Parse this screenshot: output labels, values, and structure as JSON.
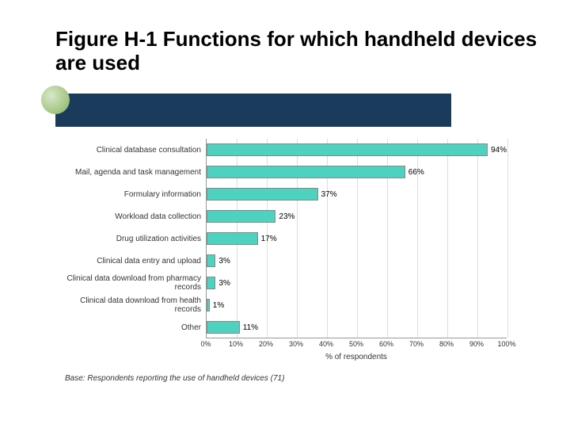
{
  "title": "Figure H-1 Functions for which handheld devices are used",
  "footnote": "Base:  Respondents reporting the use of handheld devices (71)",
  "chart_data": {
    "type": "bar",
    "orientation": "horizontal",
    "categories": [
      "Clinical database consultation",
      "Mail, agenda and task management",
      "Formulary information",
      "Workload data collection",
      "Drug utilization activities",
      "Clinical data entry and upload",
      "Clinical data download from pharmacy records",
      "Clinical data download from health records",
      "Other"
    ],
    "values": [
      94,
      66,
      37,
      23,
      17,
      3,
      3,
      1,
      11
    ],
    "value_labels": [
      "94%",
      "66%",
      "37%",
      "23%",
      "17%",
      "3%",
      "3%",
      "1%",
      "11%"
    ],
    "xlabel": "% of respondents",
    "ylabel": "",
    "xlim": [
      0,
      100
    ],
    "x_ticks": [
      0,
      10,
      20,
      30,
      40,
      50,
      60,
      70,
      80,
      90,
      100
    ],
    "x_tick_labels": [
      "0%",
      "10%",
      "20%",
      "30%",
      "40%",
      "50%",
      "60%",
      "70%",
      "80%",
      "90%",
      "100%"
    ],
    "bar_color": "#4dd2c0"
  }
}
